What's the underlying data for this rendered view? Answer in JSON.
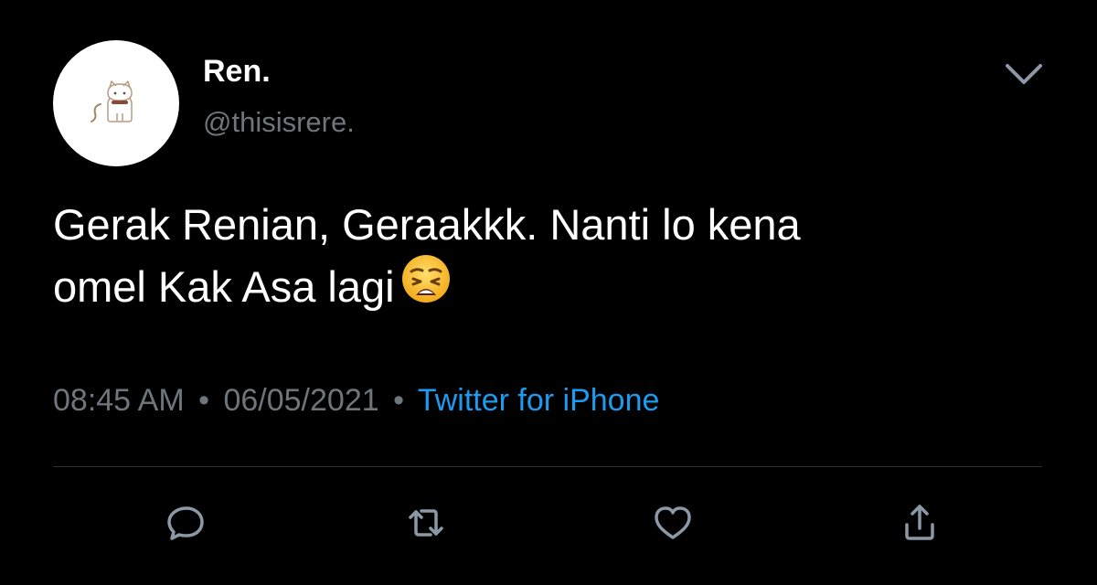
{
  "user": {
    "display_name": "Ren.",
    "handle": "@thisisrere."
  },
  "tweet": {
    "text": "Gerak Renian, Geraakkk. Nanti lo kena\nomel Kak Asa lagi",
    "emoji": "weary-face"
  },
  "meta": {
    "time": "08:45 AM",
    "separator": "•",
    "date": "06/05/2021",
    "source": "Twitter for iPhone"
  },
  "colors": {
    "background": "#000000",
    "text": "#ffffff",
    "muted": "#6e767d",
    "link": "#1d9bf0",
    "divider": "#2f3336",
    "icon": "#8b98a5"
  },
  "actions": {
    "items": [
      "reply-icon",
      "retweet-icon",
      "like-icon",
      "share-icon"
    ]
  }
}
